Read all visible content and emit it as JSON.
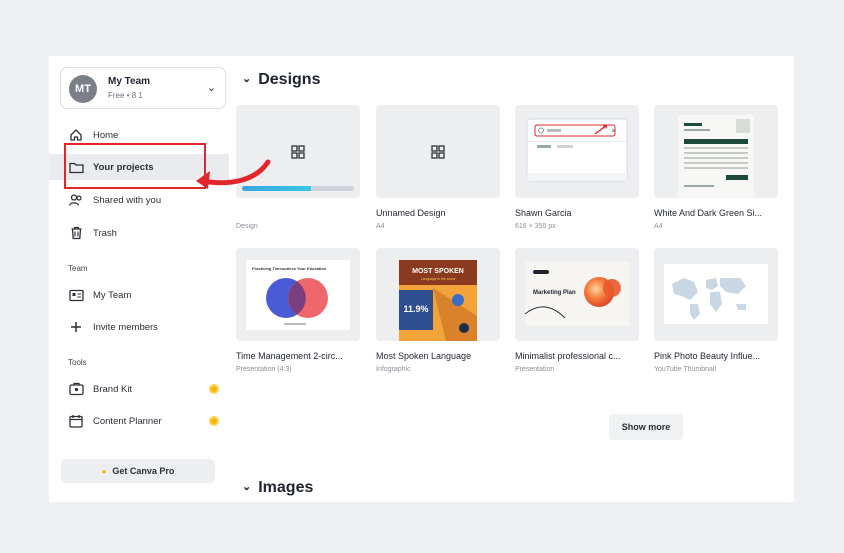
{
  "team": {
    "initials": "MT",
    "name": "My Team",
    "plan": "Free • 8 1"
  },
  "nav": {
    "home": "Home",
    "your_projects": "Your projects",
    "shared": "Shared with you",
    "trash": "Trash"
  },
  "team_section": {
    "label": "Team",
    "my_team": "My Team",
    "invite": "Invite members"
  },
  "tools_section": {
    "label": "Tools",
    "brand_kit": "Brand Kit",
    "content_planner": "Content Planner"
  },
  "pro_button": "Get Canva Pro",
  "designs": {
    "title": "Designs",
    "items": [
      {
        "title": "",
        "sub": "Design",
        "upload_progress": 0.62
      },
      {
        "title": "Unnamed Design",
        "sub": "A4"
      },
      {
        "title": "Shawn Garcia",
        "sub": "616 × 350 px"
      },
      {
        "title": "White And Dark Green Si...",
        "sub": "A4"
      },
      {
        "title": "Time Management 2-circ...",
        "sub": "Presentation (4:3)"
      },
      {
        "title": "Most Spoken Language",
        "sub": "Infographic"
      },
      {
        "title": "Minimalist professional c...",
        "sub": "Presentation"
      },
      {
        "title": "Pink Photo Beauty Influe...",
        "sub": "YouTube Thumbnail"
      }
    ]
  },
  "thumb_text": {
    "venn_heading": "Practicing Timeoutines Your Education",
    "poster_title": "MOST SPOKEN",
    "poster_sub": "Language in the world",
    "poster_stat": "11.9%",
    "marketing": "Marketing Plan"
  },
  "show_more": "Show more",
  "images": {
    "title": "Images"
  },
  "colors": {
    "highlight": "#e3262b",
    "pro_dot": "#f5b400",
    "progress": "#3aa4e3"
  }
}
